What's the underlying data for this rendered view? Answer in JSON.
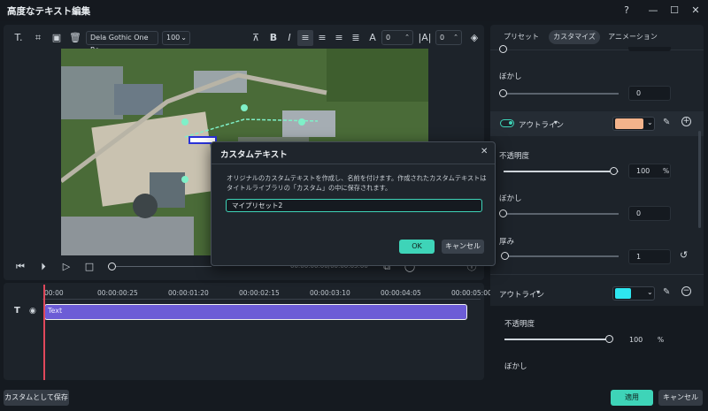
{
  "window": {
    "title": "高度なテキスト編集"
  },
  "toolbar": {
    "font": "Dela Gothic One Re",
    "size": "100",
    "spacing": "0",
    "line_spacing": "0"
  },
  "playback": {
    "timecode": "00:00:00:00/00:00:05:00"
  },
  "timeline": {
    "ticks": [
      "00:00",
      "00:00:00:25",
      "00:00:01:20",
      "00:00:02:15",
      "00:00:03:10",
      "00:00:04:05",
      "00:00:05:00"
    ],
    "clip_label": "Text"
  },
  "panel": {
    "tabs": [
      "プリセット",
      "カスタマイズ",
      "アニメーション"
    ],
    "blur1": {
      "label": "ぼかし",
      "value": "0"
    },
    "outline1": {
      "label": "アウトライン",
      "color": "#f3b38b"
    },
    "opacity1": {
      "label": "不透明度",
      "value": "100",
      "unit": "%"
    },
    "blur2": {
      "label": "ぼかし",
      "value": "0"
    },
    "thickness": {
      "label": "厚み",
      "value": "1"
    },
    "outline2": {
      "label": "アウトライン",
      "color": "#2ee6f0"
    },
    "opacity2": {
      "label": "不透明度",
      "value": "100",
      "unit": "%"
    },
    "blur3": {
      "label": "ぼかし"
    }
  },
  "dialog": {
    "title": "カスタムテキスト",
    "message": "オリジナルのカスタムテキストを作成し、名前を付けます。作成されたカスタムテキストはタイトルライブラリの「カスタム」の中に保存されます。",
    "input_value": "マイプリセット2",
    "ok": "OK",
    "cancel": "キャンセル"
  },
  "footer": {
    "save_custom": "カスタムとして保存",
    "apply": "適用",
    "cancel": "キャンセル"
  },
  "colors": {
    "accent": "#3ed4b8",
    "clip": "#6c5cd6",
    "playhead": "#e0485b"
  }
}
